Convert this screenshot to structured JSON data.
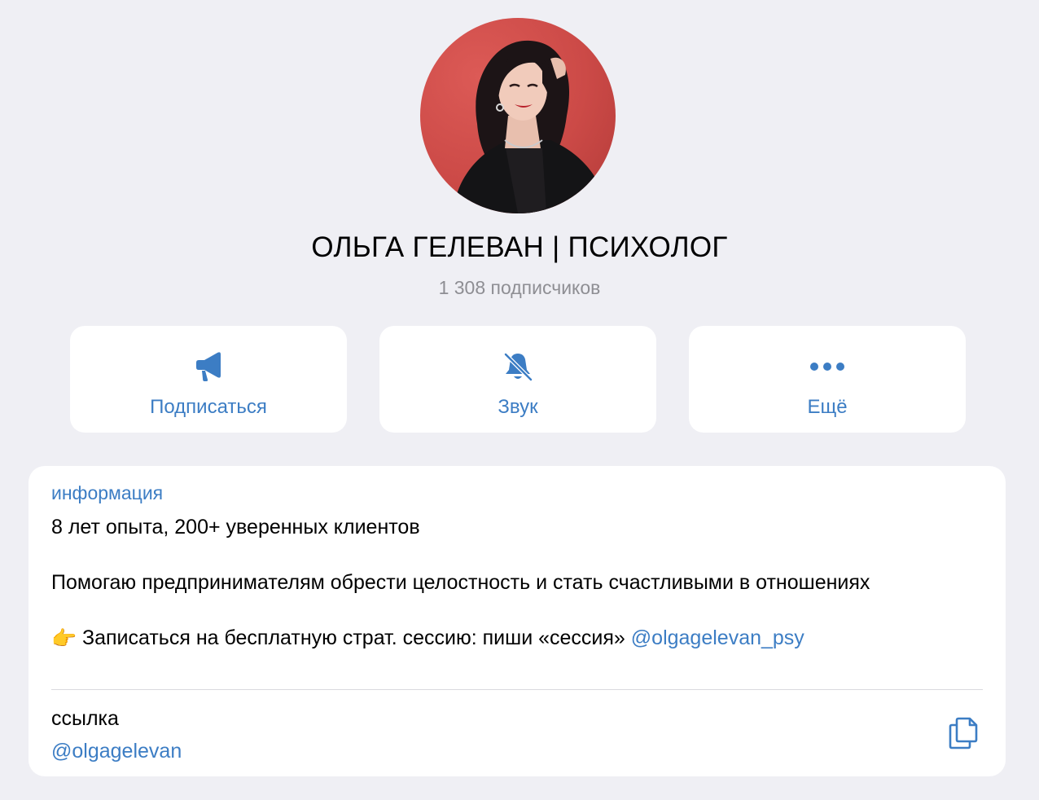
{
  "channel": {
    "title": "ОЛЬГА ГЕЛЕВАН | ПСИХОЛОГ",
    "subscribers": "1 308 подписчиков"
  },
  "actions": [
    {
      "label": "Подписаться",
      "icon": "megaphone-icon"
    },
    {
      "label": "Звук",
      "icon": "bell-muted-icon"
    },
    {
      "label": "Ещё",
      "icon": "more-dots-icon"
    }
  ],
  "info": {
    "label": "информация",
    "line1": "8 лет опыта, 200+ уверенных клиентов",
    "line2": "Помогаю предпринимателям обрести целостность и стать счастливыми в отношениях",
    "line3_emoji": "👉",
    "line3_text": "Записаться на бесплатную страт. сессию: пиши «сессия» ",
    "line3_mention": "@olgagelevan_psy"
  },
  "link": {
    "label": "ссылка",
    "value": "@olgagelevan",
    "copy_icon": "copy-icon"
  },
  "colors": {
    "accent": "#3c7dc4",
    "background": "#efeff4",
    "secondary_text": "#8e8e93",
    "avatar_bg": "#cc4a47"
  }
}
